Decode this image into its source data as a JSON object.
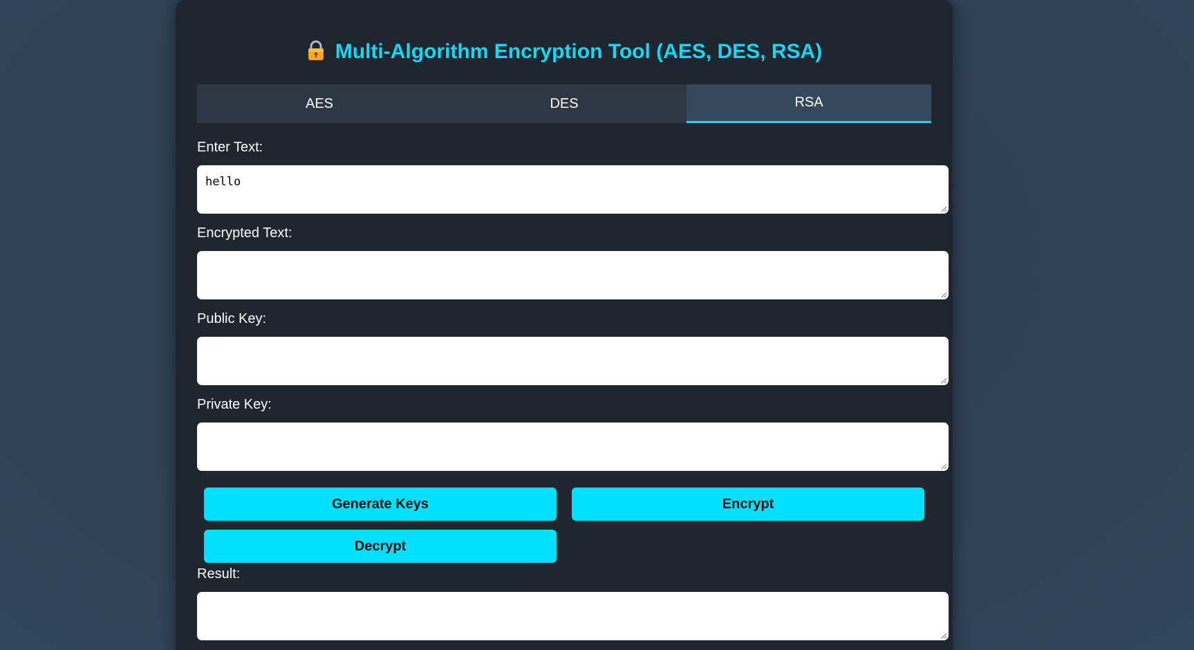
{
  "app": {
    "title": "Multi-Algorithm Encryption Tool (AES, DES, RSA)",
    "title_icon": "lock-icon",
    "accent_color": "#17d7f5"
  },
  "tabs": [
    {
      "label": "AES",
      "active": false
    },
    {
      "label": "DES",
      "active": false
    },
    {
      "label": "RSA",
      "active": true
    }
  ],
  "fields": {
    "input": {
      "label": "Enter Text:",
      "value": "hello"
    },
    "encrypted": {
      "label": "Encrypted Text:",
      "value": ""
    },
    "public_key": {
      "label": "Public Key:",
      "value": ""
    },
    "private_key": {
      "label": "Private Key:",
      "value": ""
    },
    "result": {
      "label": "Result:",
      "value": ""
    }
  },
  "buttons": {
    "generate_keys": "Generate Keys",
    "encrypt": "Encrypt",
    "decrypt": "Decrypt"
  }
}
